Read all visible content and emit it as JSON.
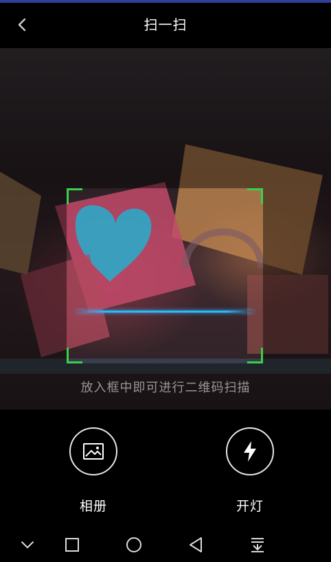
{
  "header": {
    "title": "扫一扫",
    "back_icon": "chevron-left-icon"
  },
  "scanner": {
    "hint": "放入框中即可进行二维码扫描",
    "frame_color": "#3ad14a",
    "scan_line_color": "#2fb7ff"
  },
  "actions": {
    "album": {
      "label": "相册",
      "icon": "image-icon"
    },
    "flashlight": {
      "label": "开灯",
      "icon": "lightning-icon"
    }
  },
  "navbar": {
    "items": [
      "chevron-down-icon",
      "square-icon",
      "circle-icon",
      "triangle-back-icon",
      "notification-pull-icon"
    ]
  },
  "colors": {
    "accent_bar": "#2f3f9f",
    "background": "#000000",
    "text": "#ffffff"
  }
}
